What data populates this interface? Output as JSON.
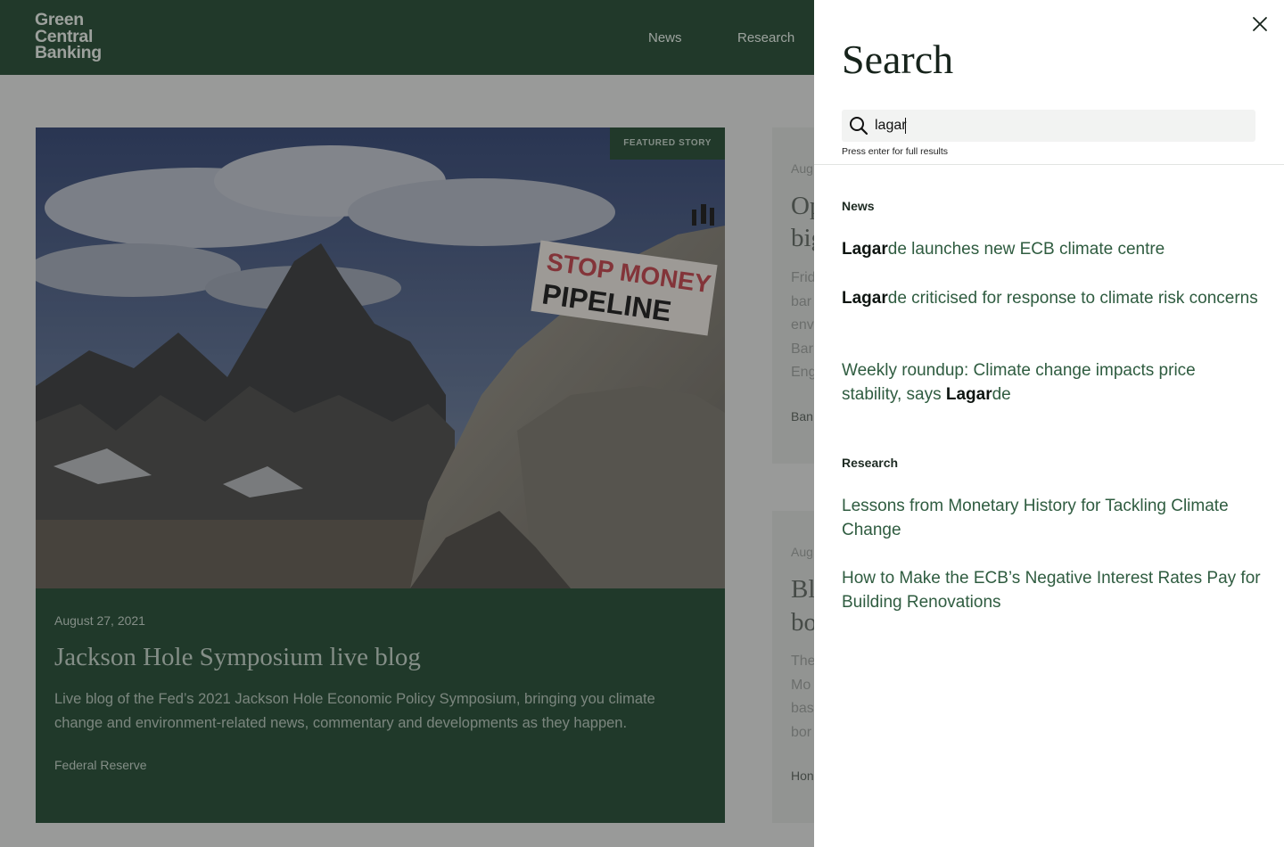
{
  "header": {
    "logo_lines": [
      "Green",
      "Central",
      "Banking"
    ],
    "nav": [
      {
        "label": "News"
      },
      {
        "label": "Research"
      }
    ]
  },
  "featured": {
    "badge": "FEATURED STORY",
    "date": "August 27, 2021",
    "title": "Jackson Hole Symposium live blog",
    "excerpt": "Live blog of the Fed’s 2021 Jackson Hole Economic Policy Symposium, bringing you climate change and environment-related news, commentary and developments as they happen.",
    "tag": "Federal Reserve",
    "banner_text": [
      "STOP MONEY",
      "PIPELINE"
    ]
  },
  "side_cards": [
    {
      "date": "Aug",
      "title_lines": [
        "Op",
        "big"
      ],
      "text_lines": [
        "Frid",
        "bar",
        "env",
        "Bar",
        "Eng"
      ],
      "tag": "Ban"
    },
    {
      "date": "Aug",
      "title_lines": [
        "Bl",
        "bo"
      ],
      "text_lines": [
        "The",
        "Mo",
        "bas",
        "bor"
      ],
      "tag": "Hon"
    }
  ],
  "search": {
    "heading": "Search",
    "query": "lagar",
    "hint": "Press enter for full results",
    "groups": [
      {
        "label": "News",
        "results": [
          {
            "pre": "",
            "match": "Lagar",
            "post": "de launches new ECB climate centre"
          },
          {
            "pre": "",
            "match": "Lagar",
            "post": "de criticised for response to climate risk concerns"
          },
          {
            "pre": "Weekly roundup: Climate change impacts price stability, says ",
            "match": "Lagar",
            "post": "de"
          }
        ]
      },
      {
        "label": "Research",
        "results": [
          {
            "pre": "Lessons from Monetary History for Tackling Climate Change",
            "match": "",
            "post": ""
          },
          {
            "pre": "How to Make the ECB’s Negative Interest Rates Pay for Building Renovations",
            "match": "",
            "post": ""
          }
        ]
      }
    ]
  },
  "colors": {
    "brand_green": "#2b4a37",
    "result_link": "#2f5c40",
    "panel_bg": "#ffffff"
  }
}
